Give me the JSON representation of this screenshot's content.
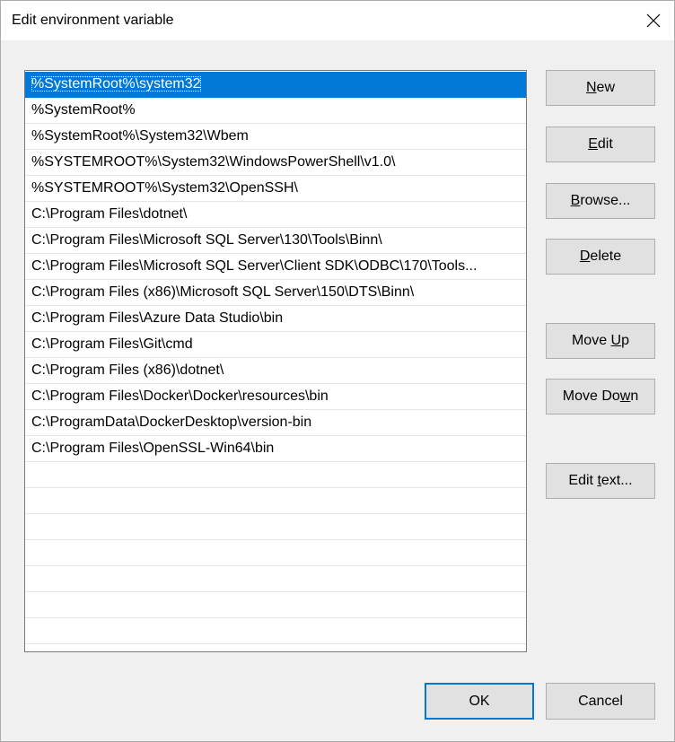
{
  "window": {
    "title": "Edit environment variable"
  },
  "path_list": {
    "selected_index": 0,
    "items": [
      "%SystemRoot%\\system32",
      "%SystemRoot%",
      "%SystemRoot%\\System32\\Wbem",
      "%SYSTEMROOT%\\System32\\WindowsPowerShell\\v1.0\\",
      "%SYSTEMROOT%\\System32\\OpenSSH\\",
      "C:\\Program Files\\dotnet\\",
      "C:\\Program Files\\Microsoft SQL Server\\130\\Tools\\Binn\\",
      "C:\\Program Files\\Microsoft SQL Server\\Client SDK\\ODBC\\170\\Tools...",
      "C:\\Program Files (x86)\\Microsoft SQL Server\\150\\DTS\\Binn\\",
      "C:\\Program Files\\Azure Data Studio\\bin",
      "C:\\Program Files\\Git\\cmd",
      "C:\\Program Files (x86)\\dotnet\\",
      "C:\\Program Files\\Docker\\Docker\\resources\\bin",
      "C:\\ProgramData\\DockerDesktop\\version-bin",
      "C:\\Program Files\\OpenSSL-Win64\\bin",
      "",
      "",
      "",
      "",
      "",
      "",
      "",
      ""
    ]
  },
  "buttons": {
    "new": {
      "pre": "",
      "key": "N",
      "post": "ew"
    },
    "edit": {
      "pre": "",
      "key": "E",
      "post": "dit"
    },
    "browse": {
      "pre": "",
      "key": "B",
      "post": "rowse..."
    },
    "delete": {
      "pre": "",
      "key": "D",
      "post": "elete"
    },
    "move_up": {
      "pre": "Move ",
      "key": "U",
      "post": "p"
    },
    "move_down": {
      "pre": "Move Do",
      "key": "w",
      "post": "n"
    },
    "edit_text": {
      "pre": "Edit ",
      "key": "t",
      "post": "ext..."
    },
    "ok": "OK",
    "cancel": "Cancel"
  },
  "colors": {
    "selection": "#0078d7",
    "button_face": "#e1e1e1",
    "dialog_bg": "#f0f0f0"
  },
  "icons": {
    "close": "close-icon"
  }
}
